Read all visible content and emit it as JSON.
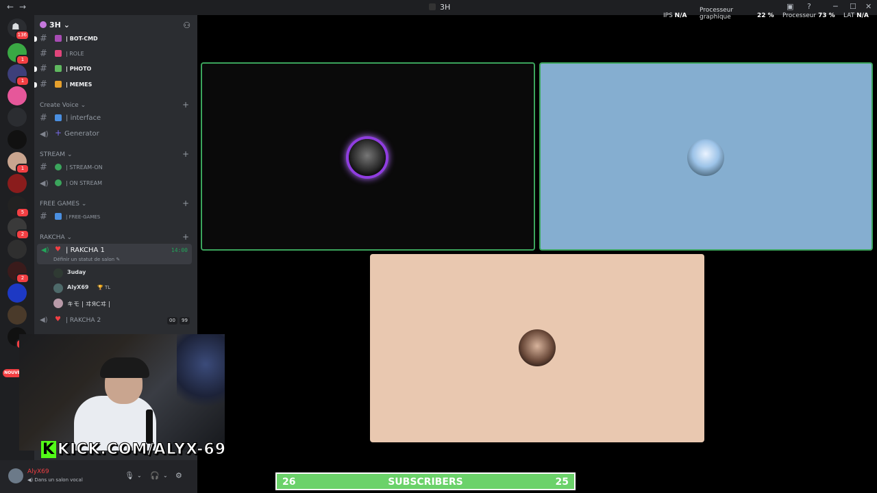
{
  "window": {
    "title": "3H",
    "back_icon": "←",
    "forward_icon": "→",
    "controls": [
      "─",
      "☐",
      "✕"
    ]
  },
  "perf": {
    "ips_label": "IPS",
    "ips_value": "N/A",
    "gpu_label_1": "Processeur",
    "gpu_label_2": "graphique",
    "gpu_value": "22 %",
    "cpu_label": "Processeur",
    "cpu_value": "73 %",
    "lat_label": "LAT",
    "lat_value": "N/A"
  },
  "rail": {
    "home_badge": "136",
    "servers": [
      {
        "color": "#3aa844",
        "badge": "1"
      },
      {
        "color": "#3d3f7a",
        "badge": "1"
      },
      {
        "color": "#e6579a",
        "badge": ""
      },
      {
        "color": "#2b2d31",
        "badge": ""
      },
      {
        "color": "#111111",
        "badge": ""
      },
      {
        "color": "#c9a58f",
        "badge": "1"
      },
      {
        "color": "#8a1c1c",
        "badge": ""
      },
      {
        "color": "#222222",
        "badge": "5"
      },
      {
        "color": "#3a3a3a",
        "badge": "2"
      },
      {
        "color": "#2f2f2f",
        "badge": ""
      },
      {
        "color": "#3a1b1b",
        "badge": "2"
      },
      {
        "color": "#1d39c4",
        "badge": ""
      },
      {
        "color": "#4a3a2a",
        "badge": ""
      },
      {
        "color": "#111111",
        "badge": "1"
      }
    ],
    "new_label": "NOUVE"
  },
  "sidebar": {
    "server_name": "3H",
    "channels_top": [
      {
        "name": "BOT-CMD",
        "emoji_color": "#a84cb4",
        "bold": true,
        "unread": true
      },
      {
        "name": "ROLE",
        "emoji_color": "#e0457b",
        "bold": false,
        "unread": false
      },
      {
        "name": "PHOTO",
        "emoji_color": "#5fb85f",
        "bold": true,
        "unread": true
      },
      {
        "name": "MEMES",
        "emoji_color": "#e6a02c",
        "bold": true,
        "unread": true
      }
    ],
    "cat_create_voice": "Create Voice",
    "ch_interface": "interface",
    "ch_generator": "Generator",
    "cat_stream": "STREAM",
    "ch_stream_on": "STREAM-ON",
    "ch_on_stream": "ON STREAM",
    "cat_free_games": "FREE GAMES",
    "ch_free_games": "FREE-GAMES",
    "cat_rakcha": "RAKCHA",
    "vc1": {
      "name": "RAKCHA 1",
      "time": "14:00",
      "status": "Définir un statut de salon"
    },
    "members": [
      {
        "name": "3uday",
        "tag": ""
      },
      {
        "name": "AlyX69",
        "tag": "TL"
      },
      {
        "name": "キモ | ヰЯCヰ |",
        "tag": ""
      }
    ],
    "vc2": {
      "name": "RAKCHA 2",
      "count1": "00",
      "count2": "99"
    },
    "separator": "|"
  },
  "user": {
    "name": "AlyX69",
    "status": "Dans un salon vocal"
  },
  "stream": {
    "kick_letter": "K",
    "kick_text": "KICK.COM/ALYX-69"
  },
  "subscribers": {
    "left": "26",
    "label": "SUBSCRIBERS",
    "right": "25"
  },
  "colors": {
    "speaking_border": "#3ba55c",
    "tile1_bg": "#0a0a0a",
    "tile2_bg": "#85aed0",
    "tile3_bg": "#e9c8b0",
    "subs_bar": "#6bd26a"
  }
}
